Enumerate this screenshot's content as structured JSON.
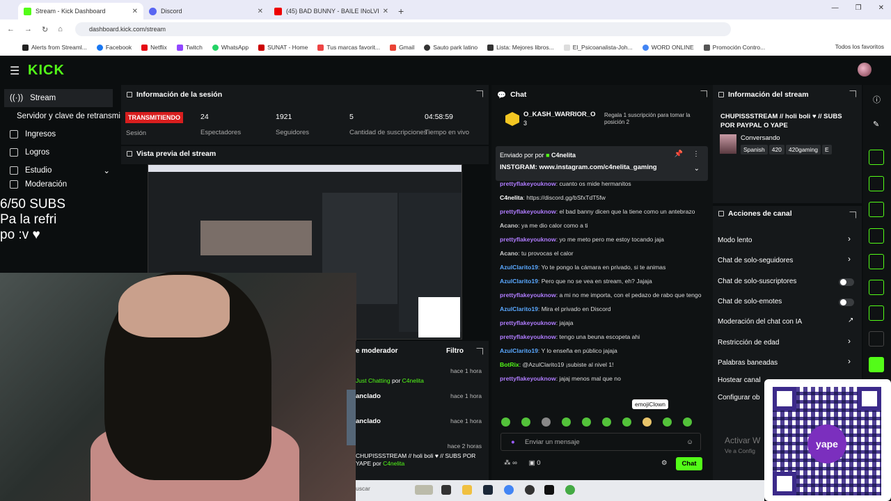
{
  "browser": {
    "tabs": [
      {
        "label": "Stream - Kick Dashboard",
        "active": true
      },
      {
        "label": "Discord",
        "active": false
      },
      {
        "label": "(45) BAD BUNNY - BAILE INoLVI...",
        "active": false
      }
    ],
    "url": "dashboard.kick.com/stream",
    "bookmarks": [
      "Alerts from Streaml...",
      "Facebook",
      "Netflix",
      "Twitch",
      "WhatsApp",
      "SUNAT - Home",
      "Tus marcas favorit...",
      "Gmail",
      "Sauto park latino",
      "Lista: Mejores libros...",
      "El_Psicoanalista-Joh...",
      "WORD ONLINE",
      "Promoción Contro..."
    ],
    "all_bookmarks": "Todos los favoritos"
  },
  "kick": {
    "logo": "KICK",
    "sidebar": [
      {
        "label": "Stream",
        "active": true
      },
      {
        "label": "Servidor y clave de retransmi"
      },
      {
        "label": "Ingresos"
      },
      {
        "label": "Logros"
      },
      {
        "label": "Estudio"
      },
      {
        "label": "Moderación"
      }
    ]
  },
  "overlay_text": [
    "6/50 SUBS",
    "Pa la refri",
    "po :v ♥"
  ],
  "session": {
    "title": "Información de la sesión",
    "status": "TRANSMITIENDO",
    "status_label": "Sesión",
    "stats": [
      {
        "value": "24",
        "label": "Espectadores"
      },
      {
        "value": "1921",
        "label": "Seguidores"
      },
      {
        "value": "5",
        "label": "Cantidad de suscripciones"
      },
      {
        "value": "04:58:59",
        "label": "Tiempo en vivo"
      }
    ]
  },
  "preview": {
    "title": "Vista previa del stream"
  },
  "logpanel": {
    "title": "e moderador",
    "filter": "Filtro",
    "rows": [
      {
        "time": "hace 1 hora",
        "text_a": "Just Chatting",
        "text_b": " por ",
        "text_c": "C4nelita"
      },
      {
        "time": "hace 1 hora",
        "title": "anclado"
      },
      {
        "time": "hace 1 hora",
        "title": "anclado"
      },
      {
        "time": "hace 2 horas",
        "text_a": "CHUPISSSTREAM // holi boli ♥ // SUBS POR YAPE",
        "text_b": " por ",
        "text_c": "C4nelita"
      }
    ]
  },
  "chat": {
    "title": "Chat",
    "hype_user": "O_KASH_WARRIOR_O",
    "hype_count": "3",
    "hype_text": "Regala 1 suscripción para tomar la posición 2",
    "pinned_by": "Enviado por",
    "pinned_user": "C4nelita",
    "pinned_text": "INSTGRAM: www.instagram.com/c4nelita_gaming",
    "messages": [
      {
        "user": "prettyflakeyouknow",
        "text": ": cuanto os mide hermanitos",
        "color": "#b07cff"
      },
      {
        "user": "C4nelita",
        "text": ": https://discord.gg/bSfxTdT5fw",
        "color": "#fff"
      },
      {
        "user": "prettyflakeyouknow",
        "text": ": el bad banny dicen que la tiene como un antebrazo",
        "color": "#b07cff"
      },
      {
        "user": "Acano",
        "text": ": ya me dio calor como a ti",
        "color": "#ccc"
      },
      {
        "user": "prettyflakeyouknow",
        "text": ": yo me meto pero me estoy tocando jaja",
        "color": "#b07cff"
      },
      {
        "user": "Acano",
        "text": ": tu provocas el calor",
        "color": "#ccc"
      },
      {
        "user": "AzulClarito19",
        "text": ": Yo te pongo la cámara en privado, si te animas",
        "color": "#5aa8ff"
      },
      {
        "user": "AzulClarito19",
        "text": ": Pero que no se vea en stream, eh? Jajaja",
        "color": "#5aa8ff"
      },
      {
        "user": "prettyflakeyouknow",
        "text": ": a mi no me importa, con el pedazo de rabo que tengo",
        "color": "#b07cff"
      },
      {
        "user": "AzulClarito19",
        "text": ": Mira el privado en Discord",
        "color": "#5aa8ff"
      },
      {
        "user": "prettyflakeyouknow",
        "text": ": jajaja",
        "color": "#b07cff"
      },
      {
        "user": "prettyflakeyouknow",
        "text": ": tengo una beuna escopeta ahi",
        "color": "#b07cff"
      },
      {
        "user": "AzulClarito19",
        "text": ": Y lo enseña en público jajaja",
        "color": "#5aa8ff"
      },
      {
        "user": "BotRix",
        "text": ": @AzulClarito19 ¡subiste al nivel 1!",
        "color": "#53fc18"
      },
      {
        "user": "prettyflakeyouknow",
        "text": ": jajaj menos mal que no",
        "color": "#b07cff"
      }
    ],
    "tooltip": "emojiClown",
    "input_placeholder": "Enviar un mensaje",
    "send": "Chat",
    "points": "0"
  },
  "stream_info": {
    "title": "Información del stream",
    "stream_title": "CHUPISSSTREAM // holi boli ♥ // SUBS POR PAYPAL O YAPE",
    "category": "Conversando",
    "tags": [
      "Spanish",
      "420",
      "420gaming",
      "E"
    ]
  },
  "channel_actions": {
    "title": "Acciones de canal",
    "items": [
      {
        "label": "Modo lento",
        "kind": "chevron"
      },
      {
        "label": "Chat de solo-seguidores",
        "kind": "chevron"
      },
      {
        "label": "Chat de solo-suscriptores",
        "kind": "toggle"
      },
      {
        "label": "Chat de solo-emotes",
        "kind": "toggle"
      },
      {
        "label": "Moderación del chat con IA",
        "kind": "ext"
      },
      {
        "label": "Restricción de edad",
        "kind": "chevron"
      },
      {
        "label": "Palabras baneadas",
        "kind": "chevron"
      },
      {
        "label": "Hostear canal",
        "kind": "none"
      },
      {
        "label": "Configurar ob",
        "kind": "none"
      }
    ]
  },
  "watermark": {
    "line1": "Activar W",
    "line2": "Ve a Config"
  },
  "qr": {
    "brand": "yape"
  },
  "taskbar": {
    "search": "uscar"
  }
}
